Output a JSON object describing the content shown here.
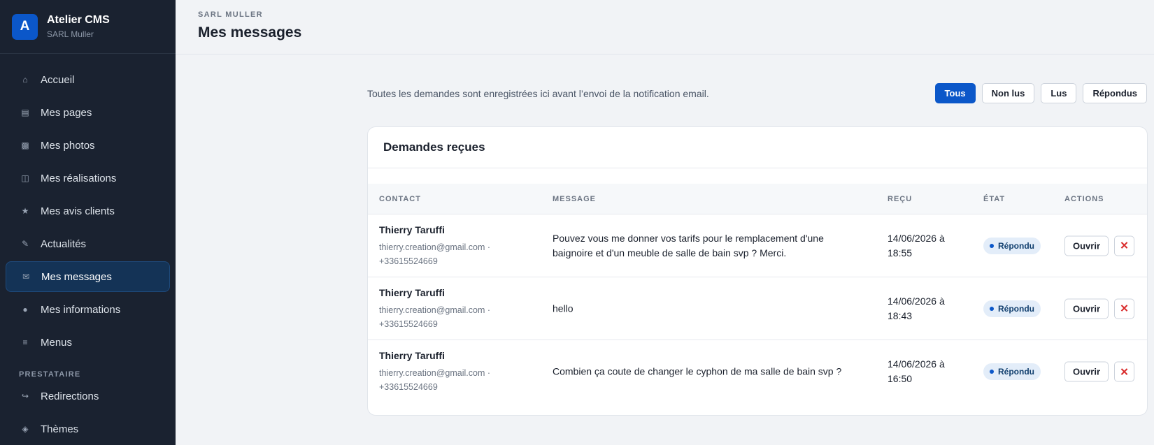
{
  "brand": {
    "logo_letter": "A",
    "title": "Atelier CMS",
    "subtitle": "SARL Muller"
  },
  "sidebar": {
    "items": [
      {
        "label": "Accueil",
        "icon": "⌂"
      },
      {
        "label": "Mes pages",
        "icon": "▤"
      },
      {
        "label": "Mes photos",
        "icon": "▩"
      },
      {
        "label": "Mes réalisations",
        "icon": "◫"
      },
      {
        "label": "Mes avis clients",
        "icon": "★"
      },
      {
        "label": "Actualités",
        "icon": "✎"
      },
      {
        "label": "Mes messages",
        "icon": "✉",
        "active": true
      },
      {
        "label": "Mes informations",
        "icon": "●"
      },
      {
        "label": "Menus",
        "icon": "≡"
      }
    ],
    "section_label": "PRESTATAIRE",
    "section_items": [
      {
        "label": "Redirections",
        "icon": "↪"
      },
      {
        "label": "Thèmes",
        "icon": "◈"
      }
    ]
  },
  "header": {
    "eyebrow": "SARL MULLER",
    "title": "Mes messages"
  },
  "intro": "Toutes les demandes sont enregistrées ici avant l’envoi de la notification email.",
  "filters": [
    {
      "label": "Tous",
      "active": true
    },
    {
      "label": "Non lus"
    },
    {
      "label": "Lus"
    },
    {
      "label": "Répondus"
    }
  ],
  "card": {
    "title": "Demandes reçues",
    "columns": {
      "contact": "CONTACT",
      "message": "MESSAGE",
      "received": "REÇU",
      "state": "ÉTAT",
      "actions": "ACTIONS"
    },
    "open_label": "Ouvrir",
    "delete_glyph": "✕",
    "rows": [
      {
        "name": "Thierry Taruffi",
        "contact": "thierry.creation@gmail.com · +33615524669",
        "message": "Pouvez vous me donner vos tarifs pour le remplacement d'une baignoire et d'un meuble de salle de bain svp ? Merci.",
        "date": "14/06/2026 à 18:55",
        "state": "Répondu"
      },
      {
        "name": "Thierry Taruffi",
        "contact": "thierry.creation@gmail.com · +33615524669",
        "message": "hello",
        "date": "14/06/2026 à 18:43",
        "state": "Répondu"
      },
      {
        "name": "Thierry Taruffi",
        "contact": "thierry.creation@gmail.com · +33615524669",
        "message": "Combien ça coute de changer le cyphon de ma salle de bain svp ?",
        "date": "14/06/2026 à 16:50",
        "state": "Répondu"
      }
    ]
  },
  "colors": {
    "sidebar_bg": "#1a2230",
    "accent": "#0b57c9",
    "active_nav": "#143356",
    "danger": "#d92b2b",
    "badge_bg": "#e3edf9"
  }
}
